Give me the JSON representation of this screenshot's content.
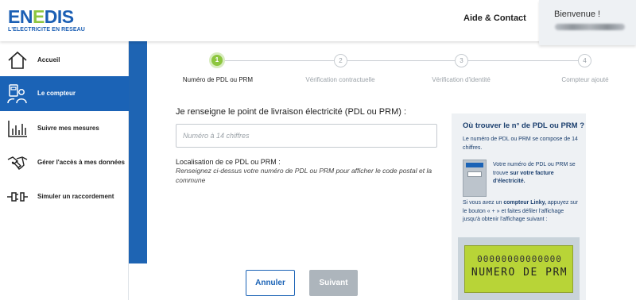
{
  "header": {
    "logo_main_a": "EN",
    "logo_main_b": "E",
    "logo_main_c": "DIS",
    "logo_sub": "L'ELECTRICITE EN RESEAU",
    "help_link": "Aide & Contact",
    "welcome": "Bienvenue !"
  },
  "sidebar": {
    "items": [
      {
        "label": "Accueil",
        "icon": "home-icon",
        "active": false
      },
      {
        "label": "Le compteur",
        "icon": "meter-icon",
        "active": true
      },
      {
        "label": "Suivre mes mesures",
        "icon": "chart-icon",
        "active": false
      },
      {
        "label": "Gérer l'accès à mes données",
        "icon": "handshake-icon",
        "active": false
      },
      {
        "label": "Simuler un raccordement",
        "icon": "plug-icon",
        "active": false
      }
    ]
  },
  "stepper": {
    "steps": [
      {
        "number": "1",
        "label": "Numéro de PDL ou PRM",
        "active": true
      },
      {
        "number": "2",
        "label": "Vérification contractuelle",
        "active": false
      },
      {
        "number": "3",
        "label": "Vérification d'identité",
        "active": false
      },
      {
        "number": "4",
        "label": "Compteur ajouté",
        "active": false
      }
    ]
  },
  "form": {
    "title": "Je renseigne le point de livraison électricité (PDL ou PRM) :",
    "input_placeholder": "Numéro à 14 chiffres",
    "input_value": "",
    "location_title": "Localisation de ce PDL ou PRM :",
    "location_desc": "Renseignez ci-dessus votre numéro de PDL ou PRM pour afficher le code postal et la commune",
    "cancel_label": "Annuler",
    "next_label": "Suivant"
  },
  "help_panel": {
    "title": "Où trouver le n° de PDL ou PRM ?",
    "intro": "Le numéro de PDL ou PRM se compose de 14 chiffres.",
    "bill_text_a": "Votre numéro de PDL ou PRM se trouve ",
    "bill_text_b": "sur votre facture d'électricité.",
    "linky_a": "Si vous avez un ",
    "linky_b": "compteur Linky,",
    "linky_c": " appuyez sur le bouton « + » et faites défiler l'affichage jusqu'à obtenir l'affichage suivant :",
    "lcd_line1": "00000000000000",
    "lcd_line2": "NUMERO DE PRM"
  },
  "colors": {
    "brand_blue": "#1b63b6",
    "brand_green": "#8dc63f",
    "disabled_gray": "#adb5bc"
  }
}
